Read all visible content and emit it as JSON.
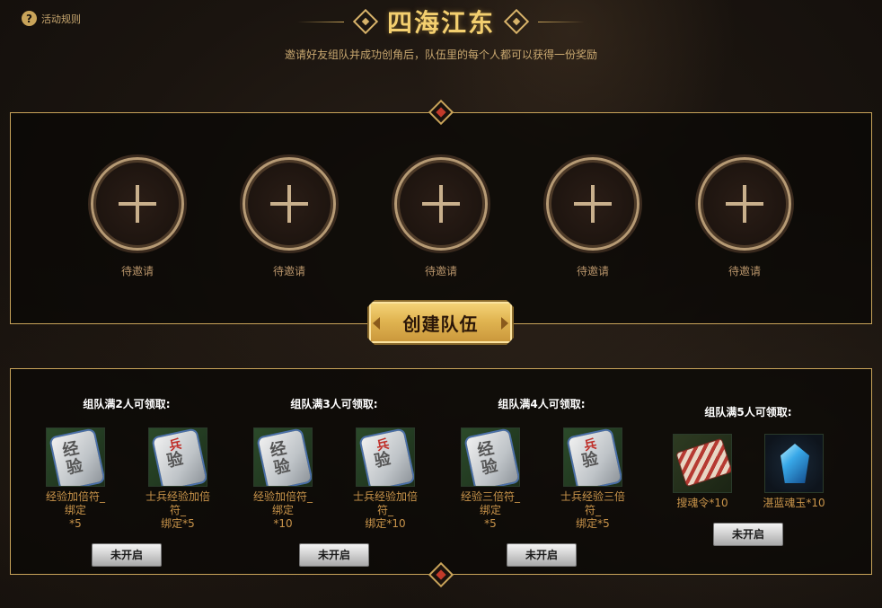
{
  "header": {
    "rules_label": "活动规则",
    "title": "四海江东",
    "subtitle": "邀请好友组队并成功创角后，队伍里的每个人都可以获得一份奖励"
  },
  "slots": [
    {
      "label": "待邀请"
    },
    {
      "label": "待邀请"
    },
    {
      "label": "待邀请"
    },
    {
      "label": "待邀请"
    },
    {
      "label": "待邀请"
    }
  ],
  "create_button": {
    "label": "创建队伍"
  },
  "rewards": [
    {
      "title": "组队满2人可领取:",
      "items": [
        {
          "name_line1": "经验加倍符_绑定",
          "name_line2": "*5",
          "icon": "exp-tag-icon"
        },
        {
          "name_line1": "士兵经验加倍符_",
          "name_line2": "绑定*5",
          "icon": "soldier-exp-tag-icon"
        }
      ],
      "button": "未开启"
    },
    {
      "title": "组队满3人可领取:",
      "items": [
        {
          "name_line1": "经验加倍符_绑定",
          "name_line2": "*10",
          "icon": "exp-tag-icon"
        },
        {
          "name_line1": "士兵经验加倍符_",
          "name_line2": "绑定*10",
          "icon": "soldier-exp-tag-icon"
        }
      ],
      "button": "未开启"
    },
    {
      "title": "组队满4人可领取:",
      "items": [
        {
          "name_line1": "经验三倍符_绑定",
          "name_line2": "*5",
          "icon": "exp-tag-icon"
        },
        {
          "name_line1": "士兵经验三倍符_",
          "name_line2": "绑定*5",
          "icon": "soldier-exp-tag-icon"
        }
      ],
      "button": "未开启"
    },
    {
      "title": "组队满5人可领取:",
      "items": [
        {
          "name_line1": "搜魂令*10",
          "name_line2": "",
          "icon": "scroll-token-icon"
        },
        {
          "name_line1": "湛蓝魂玉*10",
          "name_line2": "",
          "icon": "blue-gem-icon"
        }
      ],
      "button": "未开启"
    }
  ],
  "icon_text": {
    "exp": "经\n验",
    "soldier_mark": "兵"
  },
  "colors": {
    "title": "#f3cf6f",
    "frame": "#c9a45a",
    "reward_name": "#c9944a",
    "accent_red": "#c23a2a"
  }
}
